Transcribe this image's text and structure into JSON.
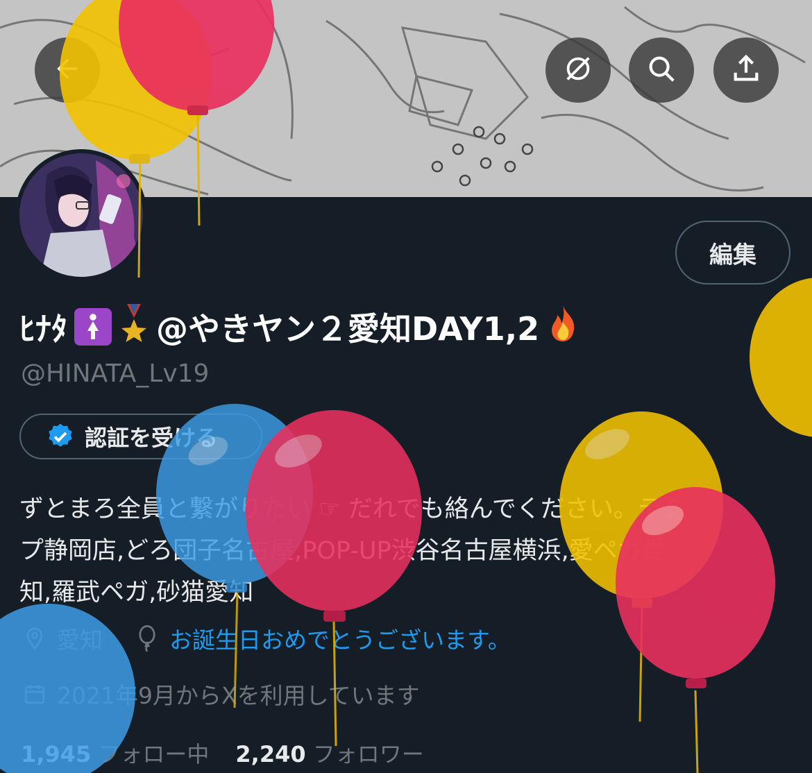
{
  "header": {
    "back_icon": "arrow-left-icon",
    "actions": [
      {
        "name": "grok-icon"
      },
      {
        "name": "search-icon"
      },
      {
        "name": "share-icon"
      }
    ]
  },
  "profile": {
    "edit_label": "編集",
    "display_name_prefix": "ﾋﾅﾀ",
    "display_name_text": "@やきヤン２愛知DAY1,2",
    "handle": "@HINATA_Lv19",
    "verify_label": "認証を受ける",
    "bio_line1": "ずとまろ全員と繋がりたい ☞ だれでも絡んでください。テク",
    "bio_line2": "プ静岡店,どろ団子名古屋,POP-UP渋谷名古屋横浜,愛ペガ愛",
    "bio_line3": "知,羅武ペガ,砂猫愛知",
    "location": "愛知",
    "birthday_message": "お誕生日おめでとうございます。",
    "joined": "2021年9月からXを利用しています",
    "following_count": "1,945",
    "following_label": "フォロー中",
    "followers_count": "2,240",
    "followers_label": "フォロワー"
  },
  "colors": {
    "background": "#151d27",
    "accent": "#1d9bf0",
    "muted": "#71767b",
    "balloon_red": "#e8305e",
    "balloon_yellow": "#f2c200",
    "balloon_blue": "#3d9ce6"
  }
}
